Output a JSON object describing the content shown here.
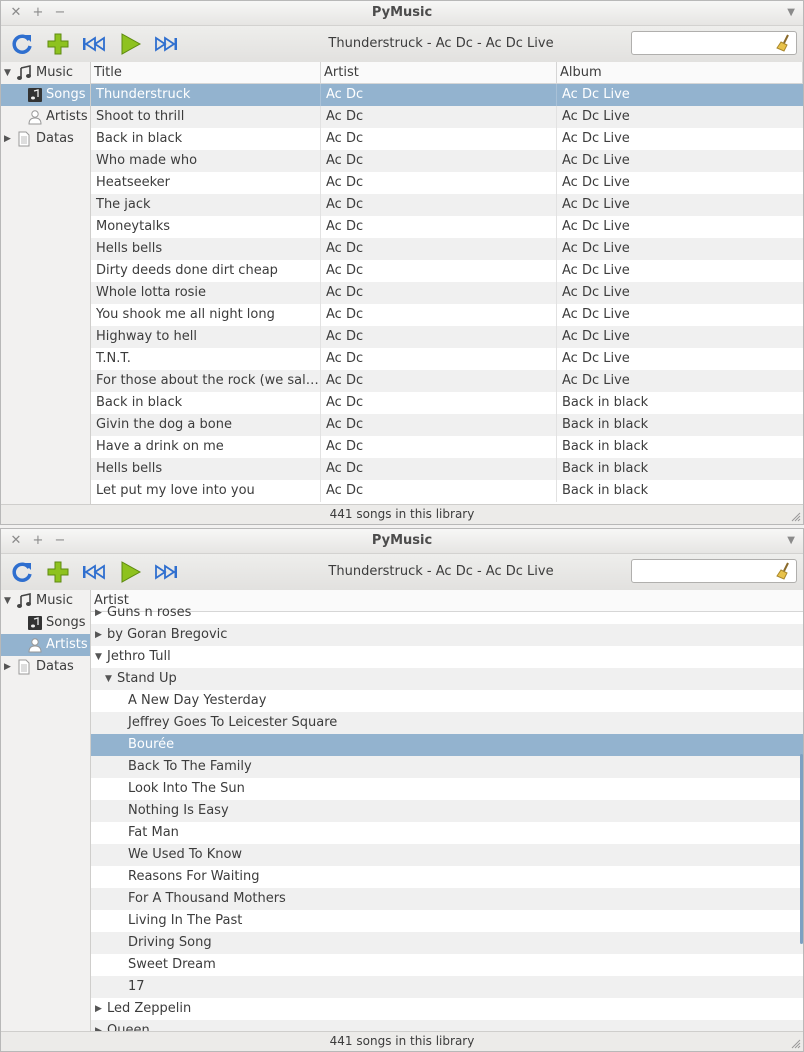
{
  "app": {
    "title": "PyMusic",
    "now_playing": "Thunderstruck - Ac Dc - Ac Dc Live",
    "search_value": "",
    "status": "441 songs in this library"
  },
  "sidebar": {
    "items": [
      {
        "label": "Music",
        "icon": "music-note-icon",
        "level": 0,
        "expander": "▼"
      },
      {
        "label": "Songs",
        "icon": "song-icon",
        "level": 1,
        "expander": ""
      },
      {
        "label": "Artists",
        "icon": "person-icon",
        "level": 1,
        "expander": ""
      },
      {
        "label": "Datas",
        "icon": "document-icon",
        "level": 0,
        "expander": "▶"
      }
    ]
  },
  "songs_table": {
    "columns": [
      "Title",
      "Artist",
      "Album"
    ],
    "rows": [
      [
        "Thunderstruck",
        "Ac Dc",
        "Ac Dc Live"
      ],
      [
        "Shoot to thrill",
        "Ac Dc",
        "Ac Dc Live"
      ],
      [
        "Back in black",
        "Ac Dc",
        "Ac Dc Live"
      ],
      [
        "Who made who",
        "Ac Dc",
        "Ac Dc Live"
      ],
      [
        "Heatseeker",
        "Ac Dc",
        "Ac Dc Live"
      ],
      [
        "The jack",
        "Ac Dc",
        "Ac Dc Live"
      ],
      [
        "Moneytalks",
        "Ac Dc",
        "Ac Dc Live"
      ],
      [
        "Hells bells",
        "Ac Dc",
        "Ac Dc Live"
      ],
      [
        "Dirty deeds done dirt cheap",
        "Ac Dc",
        "Ac Dc Live"
      ],
      [
        "Whole lotta rosie",
        "Ac Dc",
        "Ac Dc Live"
      ],
      [
        "You shook me all night long",
        "Ac Dc",
        "Ac Dc Live"
      ],
      [
        "Highway to hell",
        "Ac Dc",
        "Ac Dc Live"
      ],
      [
        "T.N.T.",
        "Ac Dc",
        "Ac Dc Live"
      ],
      [
        "For those about the rock (we salute you)",
        "Ac Dc",
        "Ac Dc Live"
      ],
      [
        "Back in black",
        "Ac Dc",
        "Back in black"
      ],
      [
        "Givin the dog a bone",
        "Ac Dc",
        "Back in black"
      ],
      [
        "Have a drink on me",
        "Ac Dc",
        "Back in black"
      ],
      [
        "Hells bells",
        "Ac Dc",
        "Back in black"
      ],
      [
        "Let put my love into you",
        "Ac Dc",
        "Back in black"
      ]
    ]
  },
  "artists_tree": {
    "column": "Artist",
    "rows": [
      {
        "label": "Guns n roses",
        "level": 0,
        "expander": "▶"
      },
      {
        "label": "by Goran Bregovic",
        "level": 0,
        "expander": "▶"
      },
      {
        "label": "Jethro Tull",
        "level": 0,
        "expander": "▼"
      },
      {
        "label": "Stand Up",
        "level": 1,
        "expander": "▼"
      },
      {
        "label": "A New Day Yesterday",
        "level": 2,
        "expander": ""
      },
      {
        "label": "Jeffrey Goes To Leicester Square",
        "level": 2,
        "expander": ""
      },
      {
        "label": "Bourée",
        "level": 2,
        "expander": "",
        "selected": true
      },
      {
        "label": "Back To The Family",
        "level": 2,
        "expander": ""
      },
      {
        "label": "Look Into The Sun",
        "level": 2,
        "expander": ""
      },
      {
        "label": "Nothing Is Easy",
        "level": 2,
        "expander": ""
      },
      {
        "label": "Fat Man",
        "level": 2,
        "expander": ""
      },
      {
        "label": "We Used To Know",
        "level": 2,
        "expander": ""
      },
      {
        "label": "Reasons For Waiting",
        "level": 2,
        "expander": ""
      },
      {
        "label": "For A Thousand Mothers",
        "level": 2,
        "expander": ""
      },
      {
        "label": "Living In The Past",
        "level": 2,
        "expander": ""
      },
      {
        "label": "Driving Song",
        "level": 2,
        "expander": ""
      },
      {
        "label": "Sweet Dream",
        "level": 2,
        "expander": ""
      },
      {
        "label": "17",
        "level": 2,
        "expander": ""
      },
      {
        "label": "Led Zeppelin",
        "level": 0,
        "expander": "▶"
      },
      {
        "label": "Queen",
        "level": 0,
        "expander": "▶"
      }
    ]
  },
  "colors": {
    "selection": "#93b3cf",
    "accent_blue": "#2f6fcf",
    "play_green": "#8ec21f"
  }
}
